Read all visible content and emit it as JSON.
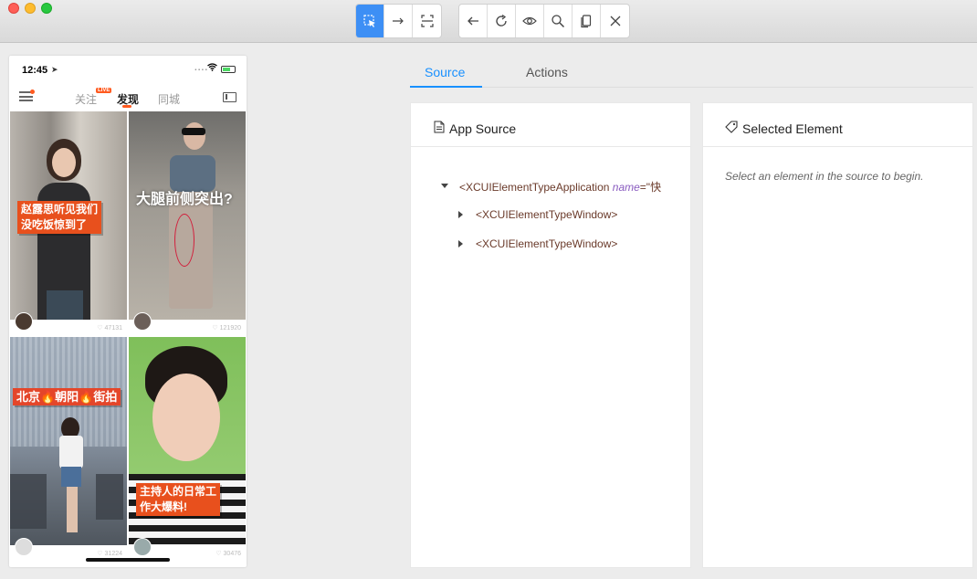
{
  "toolbar": {
    "groups": [
      [
        {
          "name": "select-icon"
        },
        {
          "name": "swipe-icon"
        },
        {
          "name": "tap-coordinates-icon"
        }
      ],
      [
        {
          "name": "back-icon"
        },
        {
          "name": "refresh-icon"
        },
        {
          "name": "eye-icon"
        },
        {
          "name": "search-icon"
        },
        {
          "name": "copy-xml-icon"
        },
        {
          "name": "close-icon"
        }
      ]
    ],
    "active": "select-icon",
    "accent": "#3d8ff5"
  },
  "phone": {
    "status": {
      "time": "12:45",
      "signal": "....",
      "wifi": "wifi-icon"
    },
    "nav": {
      "tabs": [
        "关注",
        "发现",
        "同城"
      ],
      "active": "发现",
      "live_badge": "LIVE"
    },
    "cards": [
      {
        "caption": "赵露思听见我们\n没吃饭惊到了",
        "likes": "47131"
      },
      {
        "caption": "大腿前侧突出?",
        "likes": "121920"
      },
      {
        "caption": "北京🔥朝阳🔥街拍",
        "likes": "31224"
      },
      {
        "caption": "主持人的日常工\n作大爆料!",
        "likes": "30476"
      }
    ],
    "accent": "#ff5a1f"
  },
  "tabs": {
    "items": [
      "Source",
      "Actions"
    ],
    "active": "Source",
    "accent": "#1890ff"
  },
  "source_panel": {
    "title": "App Source",
    "tree": {
      "root_tag": "<XCUIElementTypeApplication",
      "root_attr": "name",
      "root_value": "=\"快",
      "children": [
        "<XCUIElementTypeWindow>",
        "<XCUIElementTypeWindow>"
      ]
    }
  },
  "selected_panel": {
    "title": "Selected Element",
    "hint": "Select an element in the source to begin."
  }
}
